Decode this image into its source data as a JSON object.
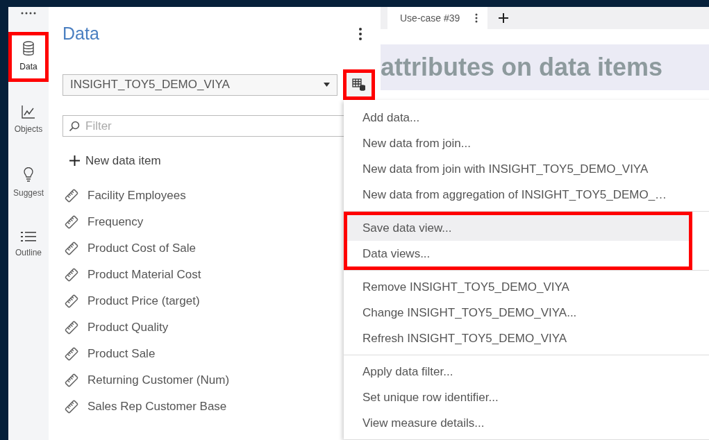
{
  "rail": {
    "items": [
      {
        "kind": "database",
        "label": "Data",
        "selected": true,
        "highlighted": true
      },
      {
        "kind": "chart",
        "label": "Objects",
        "selected": false,
        "highlighted": false
      },
      {
        "kind": "bulb",
        "label": "Suggest",
        "selected": false,
        "highlighted": false
      },
      {
        "kind": "list",
        "label": "Outline",
        "selected": false,
        "highlighted": false
      }
    ]
  },
  "data_panel": {
    "title": "Data",
    "source": {
      "value": "INSIGHT_TOY5_DEMO_VIYA",
      "highlighted": true
    },
    "filter": {
      "placeholder": "Filter"
    },
    "new_item": "New data item",
    "items": [
      "Facility Employees",
      "Frequency",
      "Product Cost of Sale",
      "Product Material Cost",
      "Product Price (target)",
      "Product Quality",
      "Product Sale",
      "Returning Customer (Num)",
      "Sales Rep Customer Base"
    ]
  },
  "tabs": [
    {
      "label": "Use-case #39",
      "selected": true
    }
  ],
  "report": {
    "heading": "attributes on data items"
  },
  "menu": {
    "sections": [
      {
        "highlighted": false,
        "items": [
          {
            "label": "Add data...",
            "hovered": false
          },
          {
            "label": "New data from join...",
            "hovered": false
          },
          {
            "label": "New data from join with INSIGHT_TOY5_DEMO_VIYA",
            "hovered": false
          },
          {
            "label": "New data from aggregation of INSIGHT_TOY5_DEMO_…",
            "hovered": false
          }
        ]
      },
      {
        "highlighted": true,
        "items": [
          {
            "label": "Save data view...",
            "hovered": true
          },
          {
            "label": "Data views...",
            "hovered": false
          }
        ]
      },
      {
        "highlighted": false,
        "items": [
          {
            "label": "Remove INSIGHT_TOY5_DEMO_VIYA",
            "hovered": false
          },
          {
            "label": "Change INSIGHT_TOY5_DEMO_VIYA...",
            "hovered": false
          },
          {
            "label": "Refresh INSIGHT_TOY5_DEMO_VIYA",
            "hovered": false
          }
        ]
      },
      {
        "highlighted": false,
        "items": [
          {
            "label": "Apply data filter...",
            "hovered": false
          },
          {
            "label": "Set unique row identifier...",
            "hovered": false
          },
          {
            "label": "View measure details...",
            "hovered": false
          }
        ]
      }
    ]
  }
}
